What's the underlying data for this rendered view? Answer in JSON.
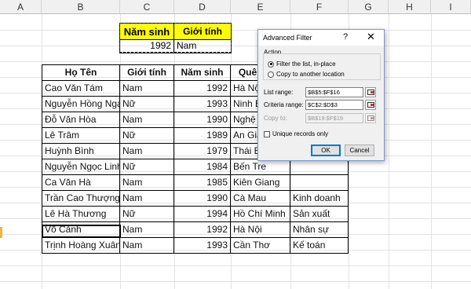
{
  "columns": [
    "A",
    "B",
    "C",
    "D",
    "E",
    "F",
    "G",
    "H",
    "I"
  ],
  "criteria": {
    "headers": [
      "Năm sinh",
      "Giới tính"
    ],
    "values": [
      "1992",
      "Nam"
    ]
  },
  "table": {
    "headers": [
      "Họ Tên",
      "Giới tính",
      "Năm sinh",
      "Quê quán",
      ""
    ],
    "rows": [
      [
        "Cao Văn Tám",
        "Nam",
        "1992",
        "Hà Nội",
        ""
      ],
      [
        "Nguyễn Hồng Nga",
        "Nữ",
        "1993",
        "Ninh Bình",
        ""
      ],
      [
        "Đỗ Văn Hòa",
        "Nam",
        "1990",
        "Nghệ An",
        ""
      ],
      [
        "Lê Trâm",
        "Nữ",
        "1989",
        "An Giang",
        ""
      ],
      [
        "Huỳnh Bình",
        "Nam",
        "1979",
        "Thái Bình",
        ""
      ],
      [
        "Nguyễn Ngọc Linh",
        "Nữ",
        "1984",
        "Bến Tre",
        ""
      ],
      [
        "Ca Văn Hà",
        "Nam",
        "1985",
        "Kiên Giang",
        ""
      ],
      [
        "Trần Cao Thượng",
        "Nam",
        "1990",
        "Cà Mau",
        "Kinh doanh"
      ],
      [
        "Lê Hà Thương",
        "Nữ",
        "1994",
        "Hồ Chí Minh",
        "Sản xuất"
      ],
      [
        "Võ Cảnh",
        "Nam",
        "1992",
        "Hà Nội",
        "Nhân sự"
      ],
      [
        "Trịnh Hoàng Xuân",
        "Nam",
        "1993",
        "Cần Thơ",
        "Kế toán"
      ]
    ]
  },
  "dialog": {
    "title": "Advanced Filter",
    "help": "?",
    "close": "✕",
    "action_label": "Action",
    "option_filter": "Filter the list, in-place",
    "option_copy": "Copy to another location",
    "list_range_label": "List range:",
    "list_range_value": "$B$5:$F$16",
    "criteria_range_label": "Criteria range:",
    "criteria_range_value": "$C$2:$D$3",
    "copy_to_label": "Copy to:",
    "copy_to_value": "$B$19:$F$19",
    "unique_label": "Unique records only",
    "ok_label": "OK",
    "cancel_label": "Cancel"
  },
  "icons": {
    "range_selector": "collapse-dialog-icon",
    "close": "close-icon",
    "help": "help-icon"
  },
  "colors": {
    "criteria_header_fill": "#ffff00",
    "active_row_marker": "#f2b43a",
    "ok_button_border": "#0078d7"
  }
}
